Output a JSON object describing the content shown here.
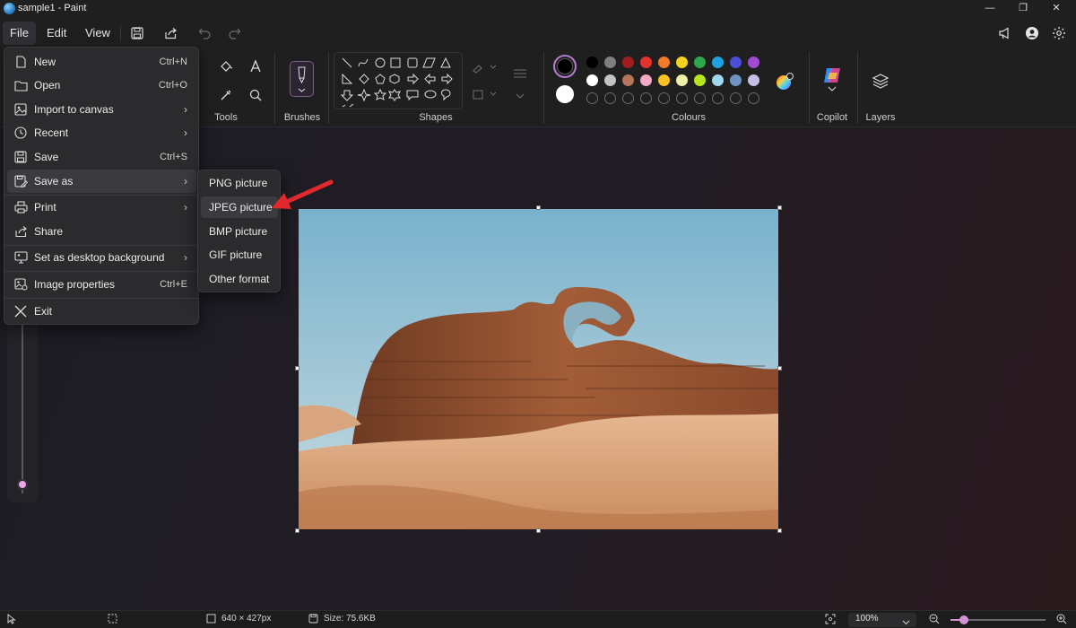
{
  "window": {
    "title": "sample1 - Paint"
  },
  "menubar": {
    "file": "File",
    "edit": "Edit",
    "view": "View"
  },
  "ribbon": {
    "groups": {
      "tools": "Tools",
      "brushes": "Brushes",
      "shapes": "Shapes",
      "colours": "Colours",
      "copilot": "Copilot",
      "layers": "Layers"
    },
    "colour_swatches_row1": [
      "#000000",
      "#7f7f7f",
      "#a11c1c",
      "#e6322f",
      "#f07c2a",
      "#f5d31c",
      "#2da84a",
      "#1fa3e0",
      "#4a4fd6",
      "#a14bd0"
    ],
    "colour_swatches_row2": [
      "#ffffff",
      "#c3c3c3",
      "#b5755a",
      "#f4a8c4",
      "#f9c220",
      "#eef0a7",
      "#b5e61d",
      "#9fd8ee",
      "#7092be",
      "#c8bfe7"
    ]
  },
  "file_menu": {
    "items": [
      {
        "label": "New",
        "shortcut": "Ctrl+N",
        "icon": "new-file-icon"
      },
      {
        "label": "Open",
        "shortcut": "Ctrl+O",
        "icon": "folder-icon"
      },
      {
        "label": "Import to canvas",
        "icon": "import-icon"
      },
      {
        "label": "Recent",
        "icon": "clock-icon"
      },
      {
        "label": "Save",
        "shortcut": "Ctrl+S",
        "icon": "save-icon"
      },
      {
        "label": "Save as",
        "icon": "save-as-icon"
      },
      {
        "label": "Print",
        "icon": "printer-icon"
      },
      {
        "label": "Share",
        "icon": "share-icon"
      },
      {
        "label": "Set as desktop background",
        "icon": "desktop-icon"
      },
      {
        "label": "Image properties",
        "shortcut": "Ctrl+E",
        "icon": "image-properties-icon"
      },
      {
        "label": "Exit",
        "icon": "close-icon"
      }
    ]
  },
  "save_as_submenu": {
    "items": [
      "PNG picture",
      "JPEG picture",
      "BMP picture",
      "GIF picture",
      "Other format"
    ],
    "highlighted": "JPEG picture"
  },
  "statusbar": {
    "dimensions": "640 × 427px",
    "size": "Size: 75.6KB",
    "zoom": "100%",
    "zoom_slider_fraction": 0.14
  },
  "size_slider": {
    "fraction": 0.0
  },
  "annotation": {
    "color": "#e0282d"
  }
}
